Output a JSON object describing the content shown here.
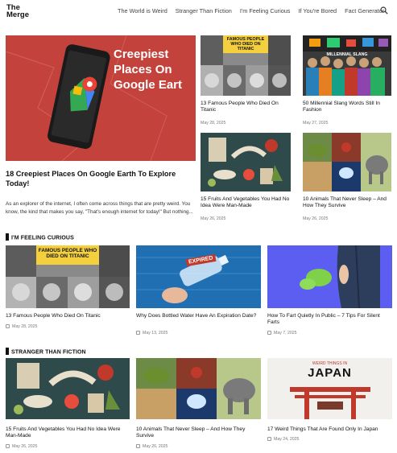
{
  "site": {
    "logo_line1": "The",
    "logo_line2": "Merge"
  },
  "nav": [
    {
      "label": "The World is Weird"
    },
    {
      "label": "Stranger Than Fiction"
    },
    {
      "label": "I'm Feeling Curious"
    },
    {
      "label": "If You're Bored"
    },
    {
      "label": "Fact Generator"
    }
  ],
  "hero": {
    "image_text": "Creepiest Places On Google Eart",
    "title": "18 Creepiest Places On Google Earth To Explore Today!",
    "excerpt": "As an explorer of the internet, I often come across things that are pretty weird. You know, the kind that makes you say, \"That's enough internet for today!\" But nothing..."
  },
  "top_grid": [
    {
      "title": "13 Famous People Who Died On Titanic",
      "date": "May 28, 2025",
      "image_text": "FAMOUS PEOPLE WHO DIED ON TITANIC"
    },
    {
      "title": "50 Millennial Slang Words Still In Fashion",
      "date": "May 27, 2025",
      "image_text": "MILLENNIAL SLANG"
    },
    {
      "title": "15 Fruits And Vegetables You Had No Idea Were Man-Made",
      "date": "May 26, 2025"
    },
    {
      "title": "10 Animals That Never Sleep – And How They Survive",
      "date": "May 26, 2025"
    }
  ],
  "sections": [
    {
      "heading": "I'M FEELING CURIOUS",
      "items": [
        {
          "title": "13 Famous People Who Died On Titanic",
          "date": "May 28, 2025",
          "image_text": "FAMOUS PEOPLE WHO DIED ON TITANIC"
        },
        {
          "title": "Why Does Bottled Water Have An Expiration Date?",
          "date": "May 13, 2025",
          "image_text": "EXPIRED"
        },
        {
          "title": "How To Fart Quietly In Public – 7 Tips For Silent Farts",
          "date": "May 7, 2025"
        }
      ]
    },
    {
      "heading": "STRANGER THAN FICTION",
      "items": [
        {
          "title": "15 Fruits And Vegetables You Had No Idea Were Man-Made",
          "date": "May 26, 2025"
        },
        {
          "title": "10 Animals That Never Sleep – And How They Survive",
          "date": "May 26, 2025"
        },
        {
          "title": "17 Weird Things That Are Found Only In Japan",
          "date": "May 24, 2025",
          "image_text_top": "WEIRD THINGS IN",
          "image_text_main": "JAPAN"
        }
      ]
    }
  ]
}
